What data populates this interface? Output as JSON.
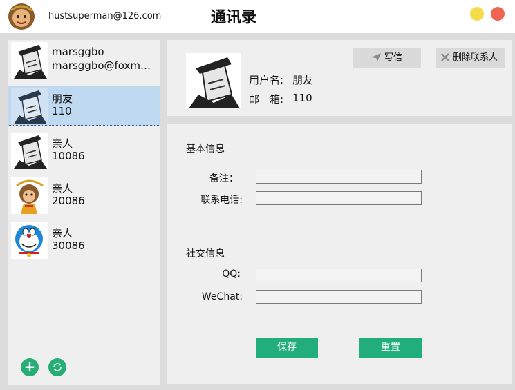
{
  "titlebar": {
    "email": "hustsuperman@126.com",
    "title": "通讯录"
  },
  "contacts": [
    {
      "name": "marsggbo",
      "sub": "marsggbo@foxmai...",
      "avatar": "hat-meme-avatar"
    },
    {
      "name": "朋友",
      "sub": "110",
      "avatar": "hat-meme-avatar"
    },
    {
      "name": "亲人",
      "sub": "10086",
      "avatar": "hat-meme-avatar"
    },
    {
      "name": "亲人",
      "sub": "20086",
      "avatar": "monkey-king-avatar"
    },
    {
      "name": "亲人",
      "sub": "30086",
      "avatar": "doraemon-avatar"
    }
  ],
  "detail": {
    "username_label": "用户名:",
    "username_value": "朋友",
    "email_label": "邮　箱:",
    "email_value": "110",
    "write_label": "写信",
    "delete_label": "删除联系人"
  },
  "form": {
    "basic_title": "基本信息",
    "remark_label": "备注：",
    "remark_value": "",
    "phone_label": "联系电话:",
    "phone_value": "",
    "social_title": "社交信息",
    "qq_label": "QQ:",
    "qq_value": "",
    "wechat_label": "WeChat:",
    "wechat_value": "",
    "save_label": "保存",
    "reset_label": "重置"
  },
  "colors": {
    "accent_green": "#22ae7b",
    "selected_bg": "#bfd9f0",
    "minimize_yellow": "#f5dc4a",
    "close_red": "#f06452"
  }
}
